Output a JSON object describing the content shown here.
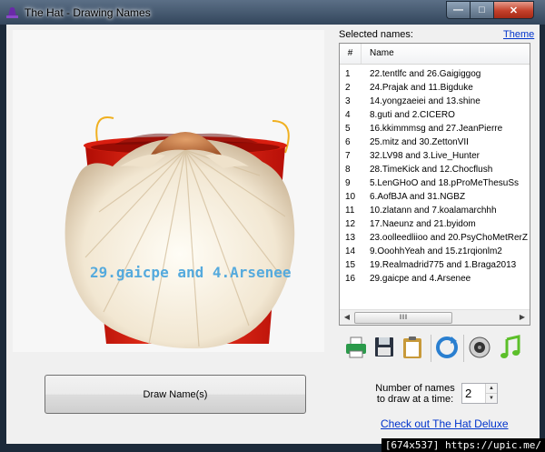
{
  "window": {
    "title": "The Hat - Drawing Names"
  },
  "draw_area": {
    "current_draw": "29.gaicpe and 4.Arsenee"
  },
  "names_panel": {
    "label": "Selected names:",
    "theme_link": "Theme",
    "columns": {
      "number": "#",
      "name": "Name"
    },
    "rows": [
      {
        "n": "1",
        "name": "22.tentlfc and 26.Gaigiggog"
      },
      {
        "n": "2",
        "name": "24.Prajak and 11.Bigduke"
      },
      {
        "n": "3",
        "name": "14.yongzaeiei and 13.shine"
      },
      {
        "n": "4",
        "name": "8.guti  and 2.CICERO"
      },
      {
        "n": "5",
        "name": "16.kkimmmsg and 27.JeanPierre"
      },
      {
        "n": "6",
        "name": "25.mitz and 30.ZettonVII"
      },
      {
        "n": "7",
        "name": "32.LV98 and 3.Live_Hunter"
      },
      {
        "n": "8",
        "name": "28.TimeKick and 12.Chocflush"
      },
      {
        "n": "9",
        "name": "5.LenGHoO and 18.pProMeThesuSs"
      },
      {
        "n": "10",
        "name": "6.AofBJA  and 31.NGBZ"
      },
      {
        "n": "11",
        "name": "10.zlatann and 7.koalamarchhh"
      },
      {
        "n": "12",
        "name": "17.Naeunz and 21.byidom"
      },
      {
        "n": "13",
        "name": "23.oolleedliioo and 20.PsyChoMetRerZ"
      },
      {
        "n": "14",
        "name": "9.OoohhYeah  and 15.z1rqionlm2"
      },
      {
        "n": "15",
        "name": "19.Realmadrid775 and 1.Braga2013"
      },
      {
        "n": "16",
        "name": "29.gaicpe and 4.Arsenee"
      }
    ]
  },
  "toolbar": {
    "icons": [
      "printer-icon",
      "save-icon",
      "clipboard-icon",
      "refresh-icon",
      "speaker-icon",
      "music-note-icon"
    ]
  },
  "controls": {
    "draw_button": "Draw Name(s)",
    "count_label": "Number of names to draw at a time:",
    "count_value": "2",
    "deluxe_link": "Check out The Hat Deluxe"
  },
  "watermark": "[674x537] https://upic.me/",
  "colors": {
    "drawn_name": "#55aadd",
    "bucket": "#e02010",
    "link": "#0033cc"
  }
}
